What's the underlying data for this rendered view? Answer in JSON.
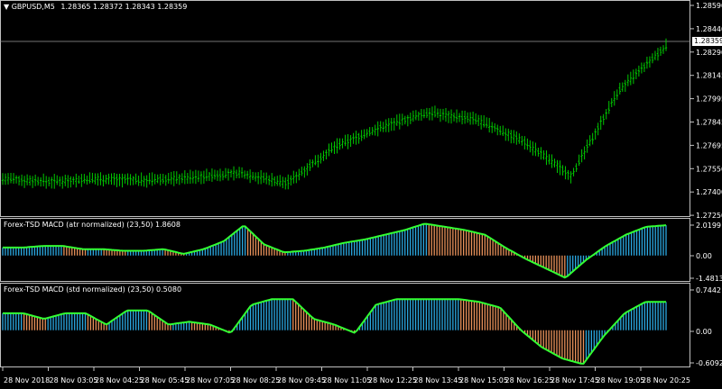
{
  "main_window": {
    "symbol_header": "GBPUSD,M5",
    "ohlc": "1.28365 1.28372 1.28343 1.28359",
    "current_price": "1.28359",
    "price_axis": [
      "1.28590",
      "1.28440",
      "1.28290",
      "1.28145",
      "1.27995",
      "1.27845",
      "1.27695",
      "1.27550",
      "1.27400",
      "1.27250"
    ]
  },
  "indicator1": {
    "label": "Forex-TSD MACD (atr normalized) (23,50)",
    "value": "1.8608",
    "axis": [
      "2.0199",
      "0.00",
      "-1.4813"
    ]
  },
  "indicator2": {
    "label": "Forex-TSD MACD (std normalized) (23,50)",
    "value": "0.5080",
    "axis": [
      "0.7442",
      "0.00",
      "-0.6092"
    ]
  },
  "time_axis": [
    "28 Nov 2018",
    "28 Nov 03:05",
    "28 Nov 04:25",
    "28 Nov 05:45",
    "28 Nov 07:05",
    "28 Nov 08:25",
    "28 Nov 09:45",
    "28 Nov 11:05",
    "28 Nov 12:25",
    "28 Nov 13:45",
    "28 Nov 15:05",
    "28 Nov 16:25",
    "28 Nov 17:45",
    "28 Nov 19:05",
    "28 Nov 20:25"
  ],
  "colors": {
    "background": "#000000",
    "candles": "#00c800",
    "hist_up": "#2aa7e0",
    "hist_down": "#e8915a",
    "signal": "#33ff33",
    "frame": "#c0c0c0"
  },
  "chart_data": [
    {
      "type": "line",
      "name": "GBPUSD,M5",
      "x": [
        "28 Nov 2018",
        "28 Nov 03:05",
        "28 Nov 04:25",
        "28 Nov 05:45",
        "28 Nov 07:05",
        "28 Nov 08:25",
        "28 Nov 09:45",
        "28 Nov 11:05",
        "28 Nov 12:25",
        "28 Nov 13:45",
        "28 Nov 15:05",
        "28 Nov 16:25",
        "28 Nov 17:45",
        "28 Nov 19:05",
        "28 Nov 20:25"
      ],
      "y": [
        1.2744,
        1.2742,
        1.2744,
        1.2743,
        1.2745,
        1.2748,
        1.2741,
        1.2766,
        1.278,
        1.279,
        1.2785,
        1.277,
        1.2746,
        1.2805,
        1.2836
      ],
      "ylim": [
        1.272,
        1.2865
      ]
    },
    {
      "type": "bar",
      "name": "Forex-TSD MACD (atr normalized)",
      "values": [
        0.5,
        0.5,
        0.6,
        0.6,
        0.4,
        0.4,
        0.3,
        0.3,
        0.4,
        0.1,
        0.4,
        0.9,
        1.9,
        0.7,
        0.2,
        0.3,
        0.5,
        0.8,
        1.0,
        1.3,
        1.6,
        2.0,
        1.8,
        1.6,
        1.3,
        0.5,
        -0.2,
        -0.8,
        -1.4,
        -0.3,
        0.6,
        1.3,
        1.8,
        1.9
      ],
      "ylim": [
        -1.4813,
        2.0199
      ]
    },
    {
      "type": "bar",
      "name": "Forex-TSD MACD (std normalized)",
      "values": [
        0.3,
        0.3,
        0.2,
        0.3,
        0.3,
        0.1,
        0.35,
        0.35,
        0.1,
        0.15,
        0.1,
        -0.05,
        0.45,
        0.55,
        0.55,
        0.2,
        0.1,
        -0.05,
        0.45,
        0.55,
        0.55,
        0.55,
        0.55,
        0.5,
        0.4,
        0.0,
        -0.3,
        -0.5,
        -0.6,
        -0.1,
        0.3,
        0.5,
        0.5
      ],
      "ylim": [
        -0.6092,
        0.7442
      ]
    }
  ]
}
